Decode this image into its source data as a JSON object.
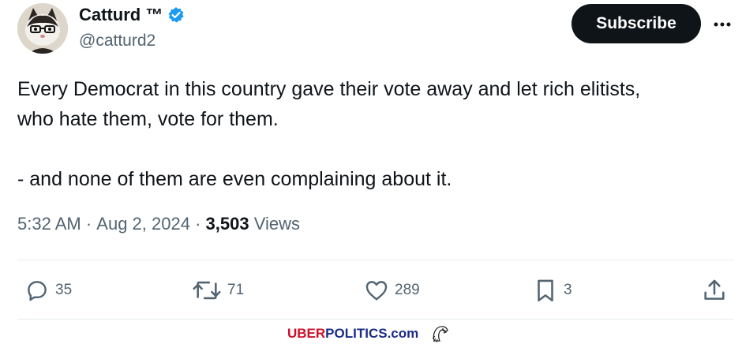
{
  "author": {
    "display_name": "Catturd ™",
    "handle": "@catturd2"
  },
  "header": {
    "subscribe_label": "Subscribe",
    "more_icon": "more-horizontal-icon"
  },
  "tweet": {
    "lines": [
      "Every Democrat in this country gave their vote away and let rich elitists,",
      "who hate them, vote for them.",
      "- and none of them are even complaining about it."
    ]
  },
  "meta": {
    "time": "5:32 AM",
    "separator": " · ",
    "date": "Aug 2, 2024",
    "views_count": "3,503",
    "views_label": " Views"
  },
  "actions": {
    "replies": "35",
    "reposts": "71",
    "likes": "289",
    "bookmarks": "3"
  },
  "watermark": {
    "part1": "UBER",
    "part2": "POLITICS",
    "part3": ".com"
  },
  "colors": {
    "text": "#0f1419",
    "secondary": "#536471",
    "verified": "#1d9bf0",
    "button": "#0f1419",
    "watermark_red": "#d0102a",
    "watermark_blue": "#1b2b86"
  }
}
